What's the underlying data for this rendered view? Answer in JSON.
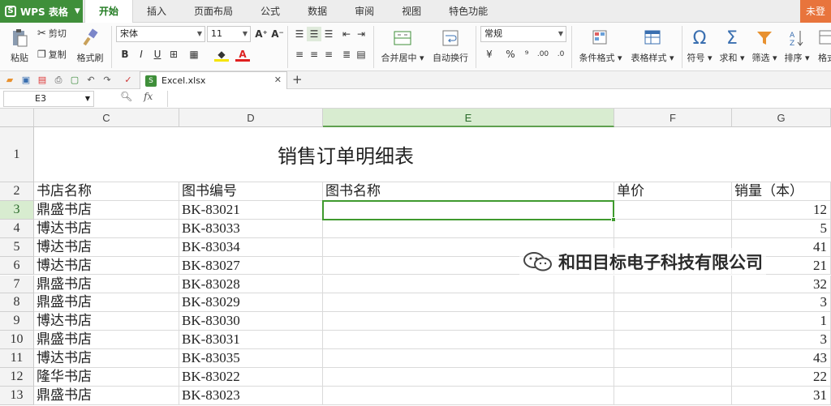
{
  "app": {
    "name": "WPS 表格",
    "login_label": "未登"
  },
  "menu_tabs": [
    "开始",
    "插入",
    "页面布局",
    "公式",
    "数据",
    "审阅",
    "视图",
    "特色功能"
  ],
  "ribbon": {
    "paste_label": "粘贴",
    "cut_label": "剪切",
    "copy_label": "复制",
    "format_painter_label": "格式刷",
    "font_name": "宋体",
    "font_size": "11",
    "merge_center_label": "合并居中",
    "wrap_text_label": "自动换行",
    "number_format": "常规",
    "conditional_format_label": "条件格式",
    "table_style_label": "表格样式",
    "symbol_label": "符号",
    "sum_label": "求和",
    "filter_label": "筛选",
    "sort_label": "排序",
    "format_label": "格式",
    "bold_label": "B",
    "italic_label": "I",
    "underline_label": "U",
    "percent_label": "%",
    "thousands_label": "⁹",
    "increase_decimal_label": ".00",
    "decrease_decimal_label": ".0",
    "increase_font_label": "A⁺",
    "decrease_font_label": "A⁻",
    "font_color_label": "A"
  },
  "doc_tab": {
    "filename": "Excel.xlsx"
  },
  "formula_bar": {
    "cell_ref": "E3",
    "fx_label": "fx",
    "formula_value": ""
  },
  "columns": [
    "C",
    "D",
    "E",
    "F",
    "G"
  ],
  "sheet": {
    "title": "销售订单明细表",
    "headers": [
      "书店名称",
      "图书编号",
      "图书名称",
      "单价",
      "销量（本）"
    ],
    "rows": [
      {
        "row": "3",
        "store": "鼎盛书店",
        "code": "BK-83021",
        "name": "",
        "price": "",
        "qty": "12"
      },
      {
        "row": "4",
        "store": "博达书店",
        "code": "BK-83033",
        "name": "",
        "price": "",
        "qty": "5"
      },
      {
        "row": "5",
        "store": "博达书店",
        "code": "BK-83034",
        "name": "",
        "price": "",
        "qty": "41"
      },
      {
        "row": "6",
        "store": "博达书店",
        "code": "BK-83027",
        "name": "",
        "price": "",
        "qty": "21"
      },
      {
        "row": "7",
        "store": "鼎盛书店",
        "code": "BK-83028",
        "name": "",
        "price": "",
        "qty": "32"
      },
      {
        "row": "8",
        "store": "鼎盛书店",
        "code": "BK-83029",
        "name": "",
        "price": "",
        "qty": "3"
      },
      {
        "row": "9",
        "store": "博达书店",
        "code": "BK-83030",
        "name": "",
        "price": "",
        "qty": "1"
      },
      {
        "row": "10",
        "store": "鼎盛书店",
        "code": "BK-83031",
        "name": "",
        "price": "",
        "qty": "3"
      },
      {
        "row": "11",
        "store": "博达书店",
        "code": "BK-83035",
        "name": "",
        "price": "",
        "qty": "43"
      },
      {
        "row": "12",
        "store": "隆华书店",
        "code": "BK-83022",
        "name": "",
        "price": "",
        "qty": "22"
      },
      {
        "row": "13",
        "store": "鼎盛书店",
        "code": "BK-83023",
        "name": "",
        "price": "",
        "qty": "31"
      }
    ]
  },
  "selected_cell": "E3",
  "watermark": {
    "text": "和田目标电子科技有限公司"
  },
  "colors": {
    "accent_green": "#3f8f3a",
    "selection_green": "#3f9a2e",
    "login_orange": "#e8743c"
  }
}
